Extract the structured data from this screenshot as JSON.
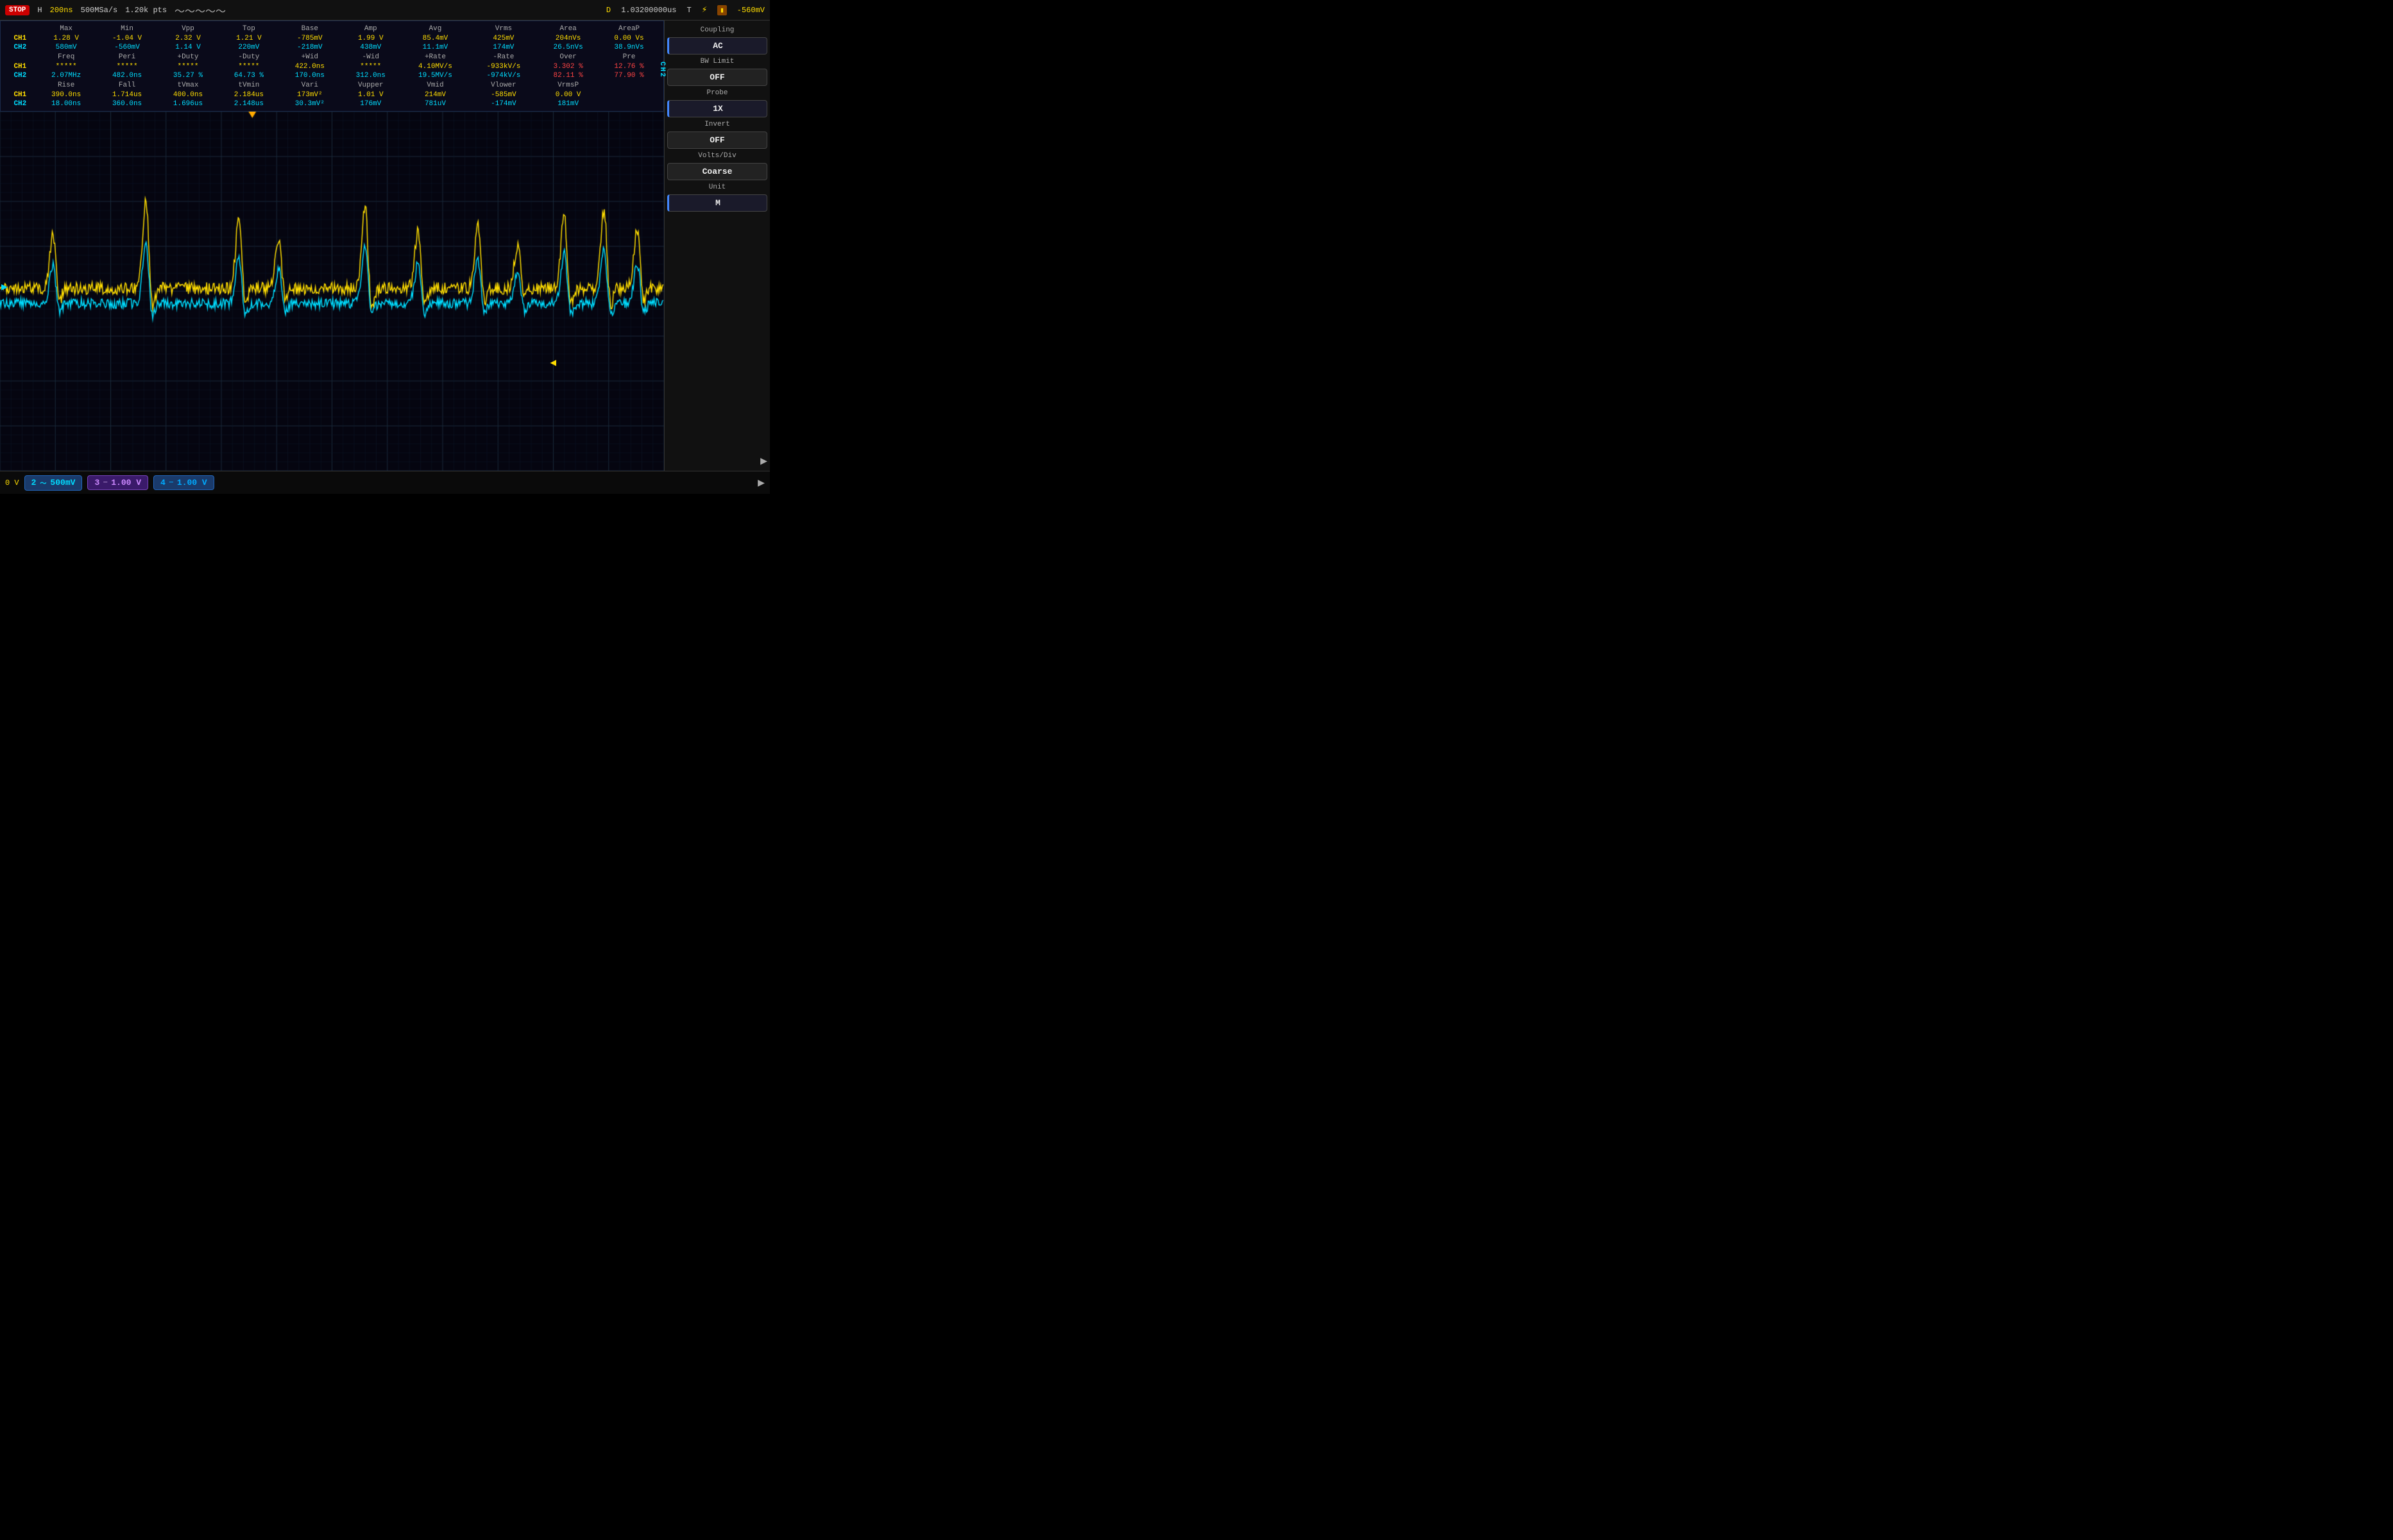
{
  "topbar": {
    "stop_label": "STOP",
    "h_label": "H",
    "timebase": "200ns",
    "sample_rate": "500MSa/s",
    "pts": "1.20k pts",
    "trigger_label": "D",
    "trigger_time": "1.03200000us",
    "t_label": "T",
    "trigger_level": "-560mV"
  },
  "measurements": {
    "headers": [
      "",
      "Max",
      "Min",
      "Vpp",
      "Top",
      "Base",
      "Amp",
      "Avg",
      "Vrms",
      "Area",
      "AreaP"
    ],
    "row1_label": "CH1",
    "ch1_row1": [
      "1.28 V",
      "-1.04 V",
      "2.32 V",
      "1.21 V",
      "-785mV",
      "1.99 V",
      "85.4mV",
      "425mV",
      "204nVs",
      "0.00 Vs"
    ],
    "ch2_row1": [
      "580mV",
      "-560mV",
      "1.14 V",
      "220mV",
      "-218mV",
      "438mV",
      "11.1mV",
      "174mV",
      "26.5nVs",
      "38.9nVs"
    ],
    "headers2": [
      "",
      "Freq",
      "Peri",
      "+Duty",
      "-Duty",
      "+Wid",
      "-Wid",
      "+Rate",
      "-Rate",
      "Over",
      "Pre"
    ],
    "ch1_row2": [
      "*****",
      "*****",
      "*****",
      "*****",
      "422.0ns",
      "*****",
      "4.10MV/s",
      "-933kV/s",
      "3.302 %",
      "12.76 %"
    ],
    "ch2_row2": [
      "2.07MHz",
      "482.0ns",
      "35.27 %",
      "64.73 %",
      "170.0ns",
      "312.0ns",
      "19.5MV/s",
      "-974kV/s",
      "82.11 %",
      "77.90 %"
    ],
    "headers3": [
      "",
      "Rise",
      "Fall",
      "tVmax",
      "tVmin",
      "Vari",
      "Vupper",
      "Vmid",
      "Vlower",
      "VrmsP"
    ],
    "ch1_row3": [
      "390.0ns",
      "1.714us",
      "400.0ns",
      "2.184us",
      "173mV²",
      "1.01 V",
      "214mV",
      "-585mV",
      "0.00 V"
    ],
    "ch2_row3": [
      "18.00ns",
      "360.0ns",
      "1.696us",
      "2.148us",
      "30.3mV²",
      "176mV",
      "781uV",
      "-174mV",
      "181mV"
    ]
  },
  "right_panel": {
    "coupling_label": "Coupling",
    "coupling_value": "AC",
    "bw_limit_label": "BW Limit",
    "bw_limit_value": "OFF",
    "probe_label": "Probe",
    "probe_value": "1X",
    "invert_label": "Invert",
    "invert_value": "OFF",
    "volts_div_label": "Volts/Div",
    "volts_div_value": "Coarse",
    "unit_label": "Unit",
    "unit_value": "M",
    "ch2_vert": "CH2"
  },
  "bottom_bar": {
    "ch1_label": "0 V",
    "ch2_num": "2",
    "ch2_val": "500mV",
    "ch3_num": "3",
    "ch3_val": "1.00 V",
    "ch4_num": "4",
    "ch4_val": "1.00 V"
  }
}
